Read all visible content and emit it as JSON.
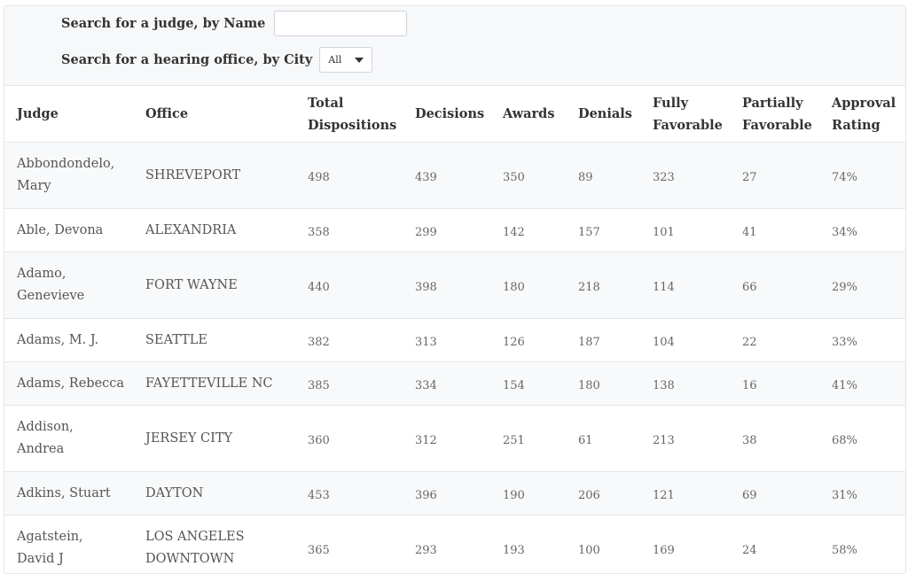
{
  "search": {
    "name_label": "Search for a judge, by Name",
    "name_value": "",
    "city_label": "Search for a hearing office, by City",
    "city_selected": "All"
  },
  "table": {
    "headers": {
      "judge": "Judge",
      "office": "Office",
      "total_dispositions": [
        "Total",
        "Dispositions"
      ],
      "decisions": "Decisions",
      "awards": "Awards",
      "denials": "Denials",
      "fully_favorable": [
        "Fully",
        "Favorable"
      ],
      "partially_favorable": [
        "Partially",
        "Favorable"
      ],
      "approval_rating": [
        "Approval",
        "Rating"
      ]
    },
    "rows": [
      {
        "judge": [
          "Abbondondelo,",
          "Mary"
        ],
        "office": [
          "SHREVEPORT"
        ],
        "total": "498",
        "decisions": "439",
        "awards": "350",
        "denials": "89",
        "fully": "323",
        "partially": "27",
        "approval": "74%"
      },
      {
        "judge": [
          "Able, Devona"
        ],
        "office": [
          "ALEXANDRIA"
        ],
        "total": "358",
        "decisions": "299",
        "awards": "142",
        "denials": "157",
        "fully": "101",
        "partially": "41",
        "approval": "34%"
      },
      {
        "judge": [
          "Adamo,",
          "Genevieve"
        ],
        "office": [
          "FORT WAYNE"
        ],
        "total": "440",
        "decisions": "398",
        "awards": "180",
        "denials": "218",
        "fully": "114",
        "partially": "66",
        "approval": "29%"
      },
      {
        "judge": [
          "Adams, M. J."
        ],
        "office": [
          "SEATTLE"
        ],
        "total": "382",
        "decisions": "313",
        "awards": "126",
        "denials": "187",
        "fully": "104",
        "partially": "22",
        "approval": "33%"
      },
      {
        "judge": [
          "Adams, Rebecca"
        ],
        "office": [
          "FAYETTEVILLE NC"
        ],
        "total": "385",
        "decisions": "334",
        "awards": "154",
        "denials": "180",
        "fully": "138",
        "partially": "16",
        "approval": "41%"
      },
      {
        "judge": [
          "Addison,",
          "Andrea"
        ],
        "office": [
          "JERSEY CITY"
        ],
        "total": "360",
        "decisions": "312",
        "awards": "251",
        "denials": "61",
        "fully": "213",
        "partially": "38",
        "approval": "68%"
      },
      {
        "judge": [
          "Adkins, Stuart"
        ],
        "office": [
          "DAYTON"
        ],
        "total": "453",
        "decisions": "396",
        "awards": "190",
        "denials": "206",
        "fully": "121",
        "partially": "69",
        "approval": "31%"
      },
      {
        "judge": [
          "Agatstein,",
          "David J"
        ],
        "office": [
          "LOS ANGELES",
          "DOWNTOWN"
        ],
        "total": "365",
        "decisions": "293",
        "awards": "193",
        "denials": "100",
        "fully": "169",
        "partially": "24",
        "approval": "58%"
      }
    ]
  }
}
